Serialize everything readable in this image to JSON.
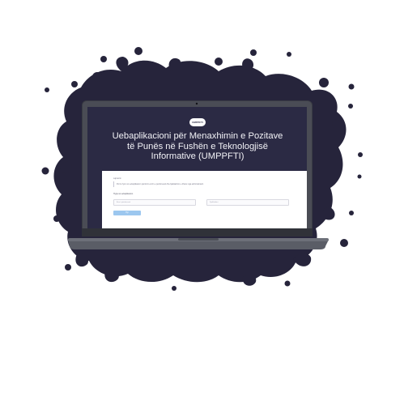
{
  "app": {
    "logo_text": "UMPPFTI",
    "title_line1": "Uebaplikacioni për Menaxhimin e Pozitave",
    "title_line2": "të Punës në Fushën e Teknologjisë",
    "title_line3": "Informative (UMPPFTI)"
  },
  "login_card": {
    "label": "Lajmërim",
    "note": "Për të hyrë në uebaplikacion përdorni emrin e përdoruesit dhe fjalëkalimin e dhënë nga administratori.",
    "section_title": "Hyrja në uebaplikacion",
    "username_placeholder": "Emri i përdoruesit",
    "password_placeholder": "Fjalëkalimi",
    "login_label": "Hyr"
  },
  "colors": {
    "splash": "#26243b",
    "screen": "#2b2a44",
    "laptop_frame": "#3a3c44",
    "accent_button": "#9cc7ef"
  }
}
